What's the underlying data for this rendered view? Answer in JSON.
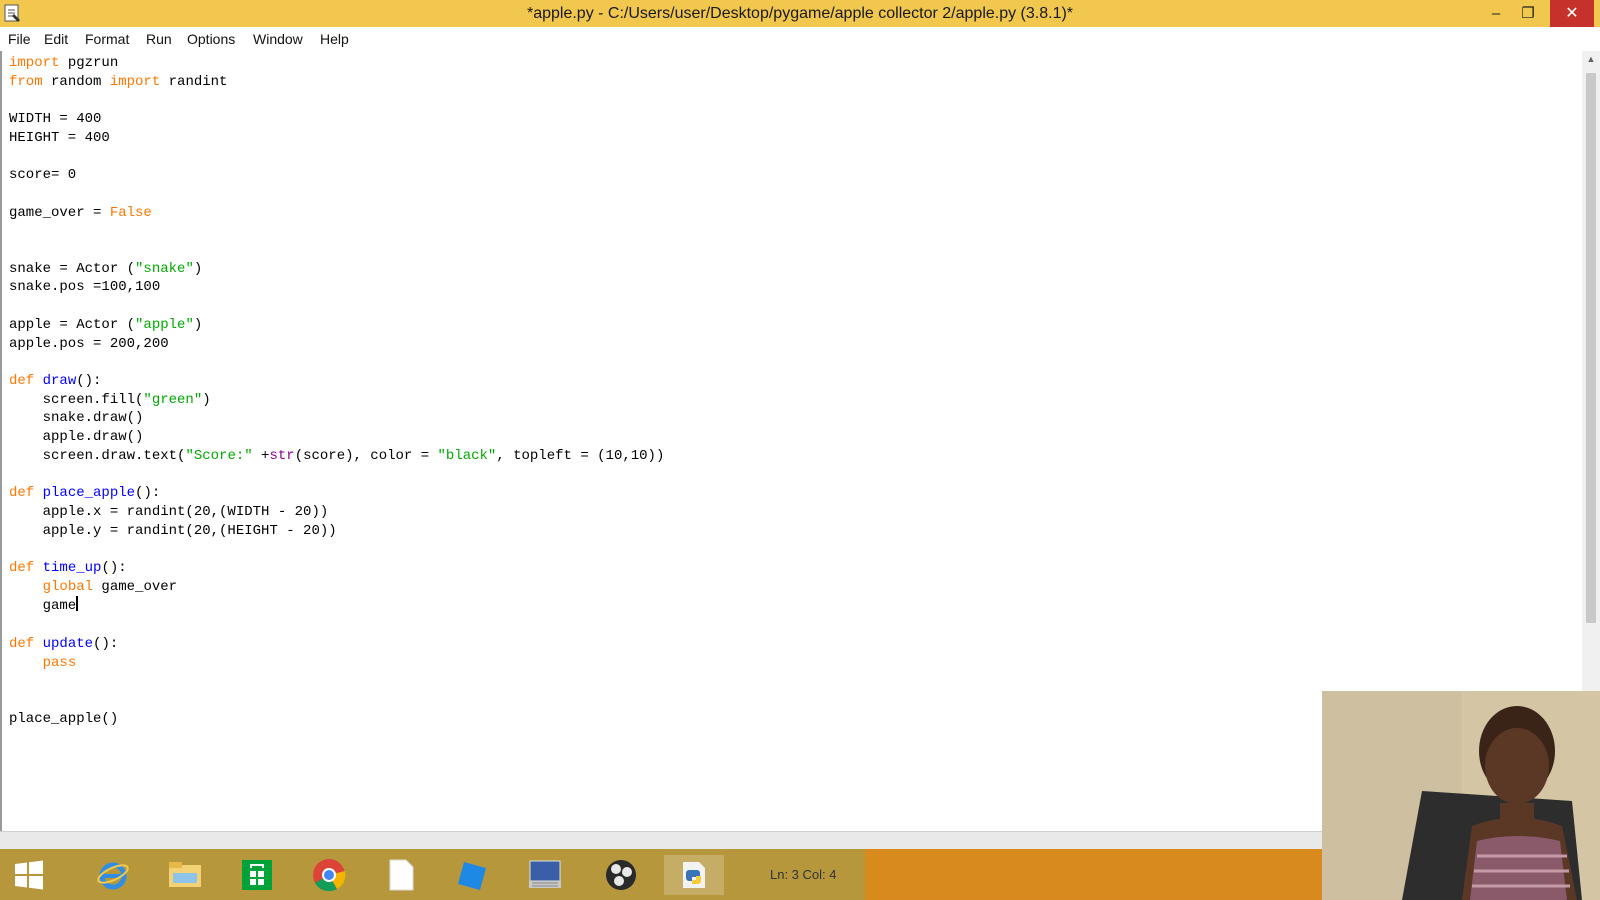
{
  "window": {
    "title": "*apple.py - C:/Users/user/Desktop/pygame/apple collector 2/apple.py (3.8.1)*",
    "minimize_glyph": "–",
    "maximize_glyph": "❐",
    "close_glyph": "✕"
  },
  "menu": {
    "items": [
      "File",
      "Edit",
      "Format",
      "Run",
      "Options",
      "Window",
      "Help"
    ]
  },
  "editor": {
    "lines": [
      "import pgzrun",
      "from random import randint",
      "",
      "WIDTH = 400",
      "HEIGHT = 400",
      "",
      "score= 0",
      "",
      "game_over = False",
      "",
      "",
      "snake = Actor (\"snake\")",
      "snake.pos =100,100",
      "",
      "apple = Actor (\"apple\")",
      "apple.pos = 200,200",
      "",
      "def draw():",
      "    screen.fill(\"green\")",
      "    snake.draw()",
      "    apple.draw()",
      "    screen.draw.text(\"Score:\" +str(score), color = \"black\", topleft = (10,10))",
      "",
      "def place_apple():",
      "    apple.x = randint(20,(WIDTH - 20))",
      "    apple.y = randint(20,(HEIGHT - 20))",
      "",
      "def time_up():",
      "    global game_over",
      "    game",
      "",
      "def update():",
      "    pass",
      "",
      "",
      "place_apple()"
    ],
    "syntax_colors": {
      "keyword": "#ff7700",
      "definition": "#0000ff",
      "string": "#00aa00",
      "builtin": "#900090",
      "default": "#000000"
    }
  },
  "status": {
    "position": "Ln: 3   Col: 4"
  },
  "taskbar": {
    "icons": [
      "windows-start-icon",
      "internet-explorer-icon",
      "file-explorer-icon",
      "store-icon",
      "chrome-icon",
      "blank-document-icon",
      "blue-app-icon",
      "onscreen-keyboard-icon",
      "obs-icon",
      "python-idle-icon"
    ]
  },
  "colors": {
    "titlebar": "#f1c74d",
    "taskbar": "#b7973c",
    "taskbar_accent": "#d88b1c",
    "close_button": "#c7312b"
  }
}
